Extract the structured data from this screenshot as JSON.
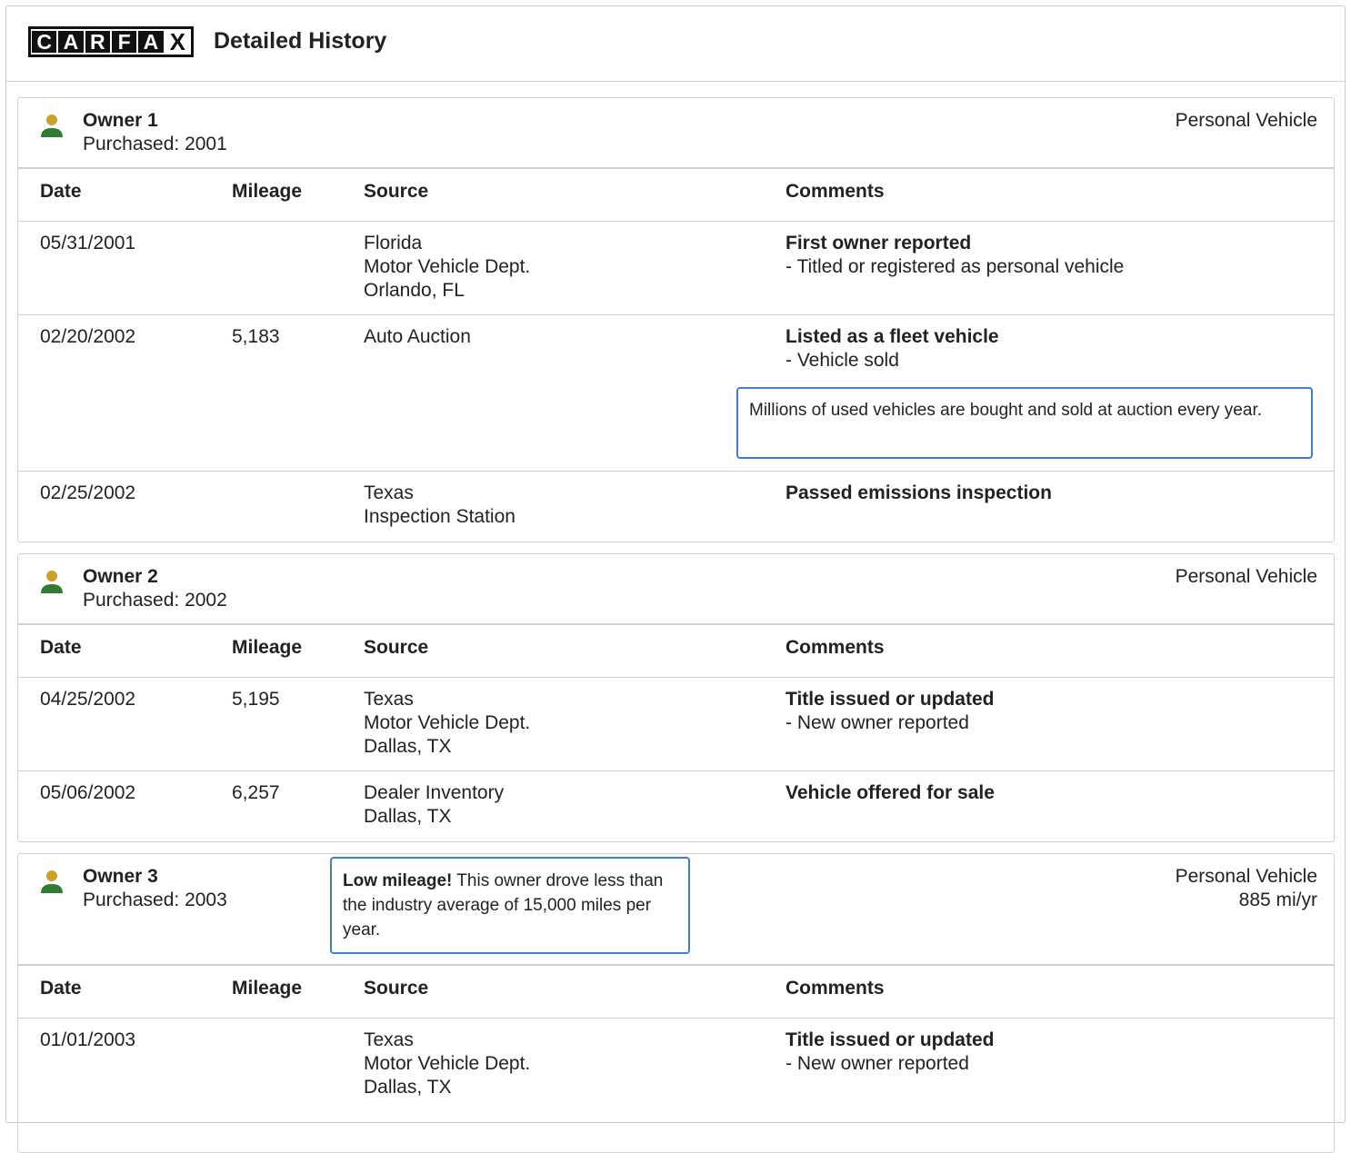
{
  "header": {
    "logo_letters": [
      "C",
      "A",
      "R",
      "F",
      "A",
      "X"
    ],
    "title": "Detailed History"
  },
  "columns": {
    "date": "Date",
    "mileage": "Mileage",
    "source": "Source",
    "comments": "Comments"
  },
  "owners": [
    {
      "title": "Owner 1",
      "purchased": "Purchased: 2001",
      "type": "Personal Vehicle",
      "rows": [
        {
          "date": "05/31/2001",
          "mileage": "",
          "source": [
            "Florida",
            "Motor Vehicle Dept.",
            "Orlando, FL"
          ],
          "comment_title": "First owner reported",
          "comment_detail": "- Titled or registered as personal vehicle"
        },
        {
          "date": "02/20/2002",
          "mileage": "5,183",
          "source": [
            "Auto Auction"
          ],
          "comment_title": "Listed as a fleet vehicle",
          "comment_detail": "- Vehicle sold",
          "note": "Millions of used vehicles are bought and sold at auction every year."
        },
        {
          "date": "02/25/2002",
          "mileage": "",
          "source": [
            "Texas",
            "Inspection Station"
          ],
          "comment_title": "Passed emissions inspection",
          "comment_detail": ""
        }
      ]
    },
    {
      "title": "Owner 2",
      "purchased": "Purchased: 2002",
      "type": "Personal Vehicle",
      "rows": [
        {
          "date": "04/25/2002",
          "mileage": "5,195",
          "source": [
            "Texas",
            "Motor Vehicle Dept.",
            "Dallas, TX"
          ],
          "comment_title": "Title issued or updated",
          "comment_detail": "- New owner reported"
        },
        {
          "date": "05/06/2002",
          "mileage": "6,257",
          "source": [
            "Dealer Inventory",
            "Dallas, TX"
          ],
          "comment_title": "Vehicle offered for sale",
          "comment_detail": ""
        }
      ]
    },
    {
      "title": "Owner 3",
      "purchased": "Purchased: 2003",
      "type": "Personal Vehicle",
      "rate": "885 mi/yr",
      "note_bold": "Low mileage!",
      "note_text": " This owner drove less than the industry average of 15,000 miles per year.",
      "rows": [
        {
          "date": "01/01/2003",
          "mileage": "",
          "source": [
            "Texas",
            "Motor Vehicle Dept.",
            "Dallas, TX"
          ],
          "comment_title": "Title issued or updated",
          "comment_detail": "- New owner reported"
        }
      ]
    }
  ],
  "icons": {
    "owner": "person-icon"
  },
  "colors": {
    "person_head": "#c9a227",
    "person_body": "#2e7d32",
    "note_border": "#3f7fd2"
  }
}
